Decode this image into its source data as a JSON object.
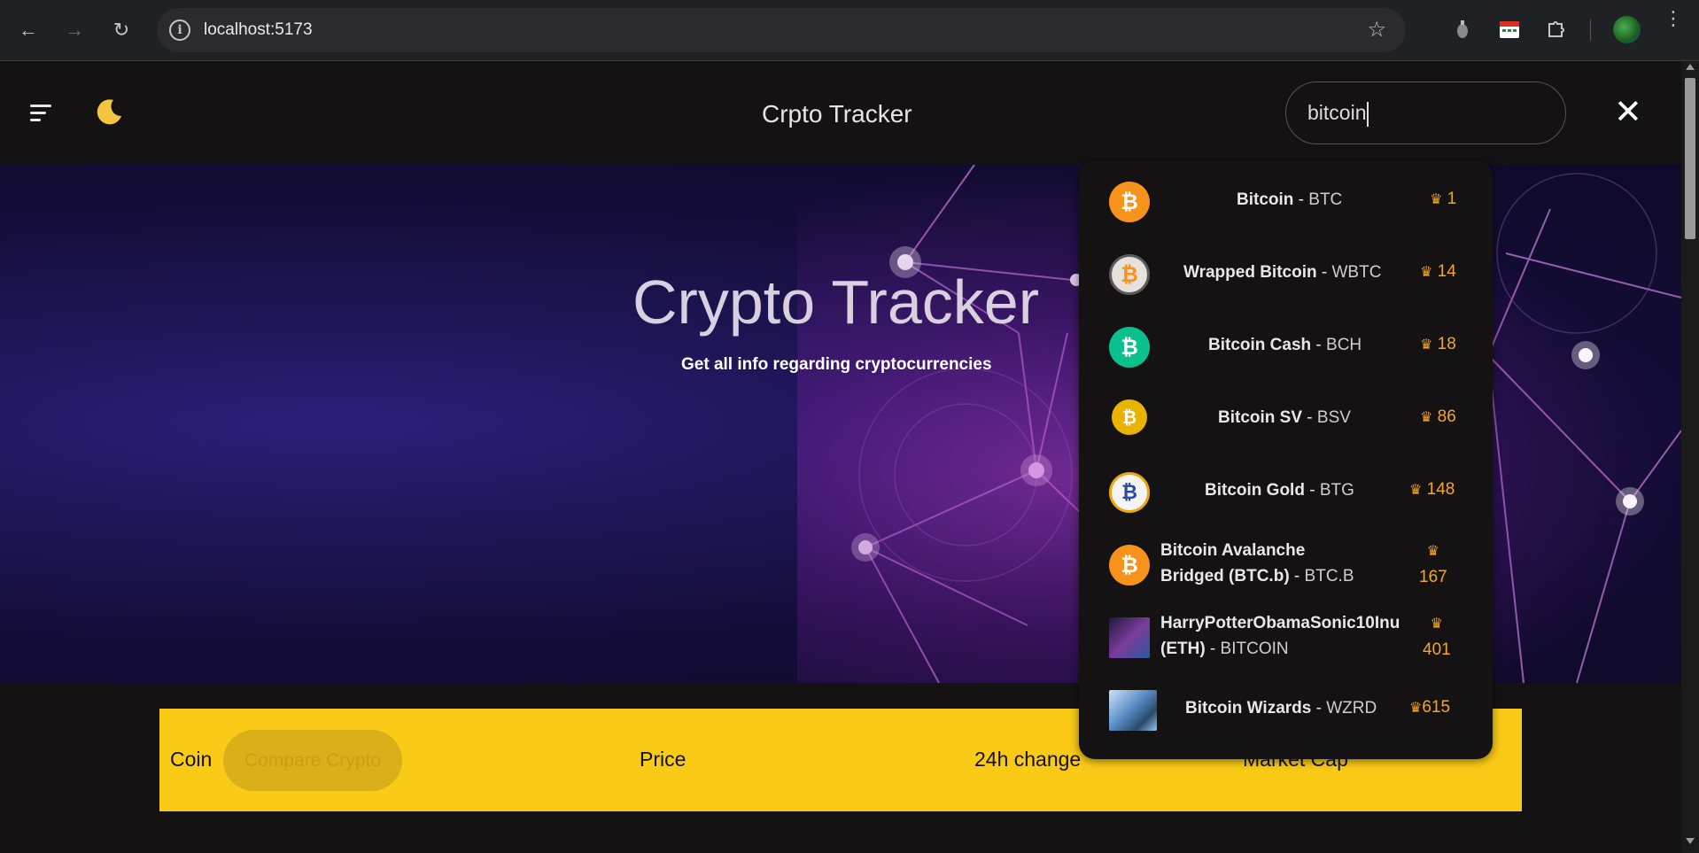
{
  "browser": {
    "url": "localhost:5173",
    "back_icon": "←",
    "forward_icon": "→",
    "reload_icon": "↻"
  },
  "header": {
    "title": "Crpto Tracker",
    "search_value": "bitcoin"
  },
  "hero": {
    "title": "Crypto Tracker",
    "subtitle": "Get all info regarding cryptocurrencies"
  },
  "table": {
    "col_coin": "Coin",
    "compare_label": "Compare Crypto",
    "col_price": "Price",
    "col_change": "24h change",
    "col_market_cap": "Market Cap"
  },
  "results": [
    {
      "name": "Bitcoin",
      "symbol": "BTC",
      "rank": "1",
      "icon": "bitcoin-icon",
      "color": "#f7931a"
    },
    {
      "name": "Wrapped Bitcoin",
      "symbol": "WBTC",
      "rank": "14",
      "icon": "wrapped-bitcoin-icon",
      "color": "#e0dad3"
    },
    {
      "name": "Bitcoin Cash",
      "symbol": "BCH",
      "rank": "18",
      "icon": "bitcoin-cash-icon",
      "color": "#0ac18e"
    },
    {
      "name": "Bitcoin SV",
      "symbol": "BSV",
      "rank": "86",
      "icon": "bitcoin-sv-icon",
      "color": "#eab300"
    },
    {
      "name": "Bitcoin Gold",
      "symbol": "BTG",
      "rank": "148",
      "icon": "bitcoin-gold-icon",
      "color": "#eba809"
    },
    {
      "name_line1": "Bitcoin Avalanche",
      "name_line2": "Bridged (BTC.b)",
      "symbol": "BTC.B",
      "rank": "167",
      "icon": "bitcoin-avalanche-icon",
      "color": "#f7931a"
    },
    {
      "name_line1": "HarryPotterObamaSonic10Inu",
      "name_line2": "(ETH)",
      "symbol": "BITCOIN",
      "rank": "401",
      "icon": "harrypotter-coin-icon",
      "color": "#3a2a6a"
    },
    {
      "name": "Bitcoin Wizards",
      "symbol": "WZRD",
      "rank": "615",
      "icon": "bitcoin-wizards-icon",
      "color": "#5b8fc7"
    }
  ]
}
